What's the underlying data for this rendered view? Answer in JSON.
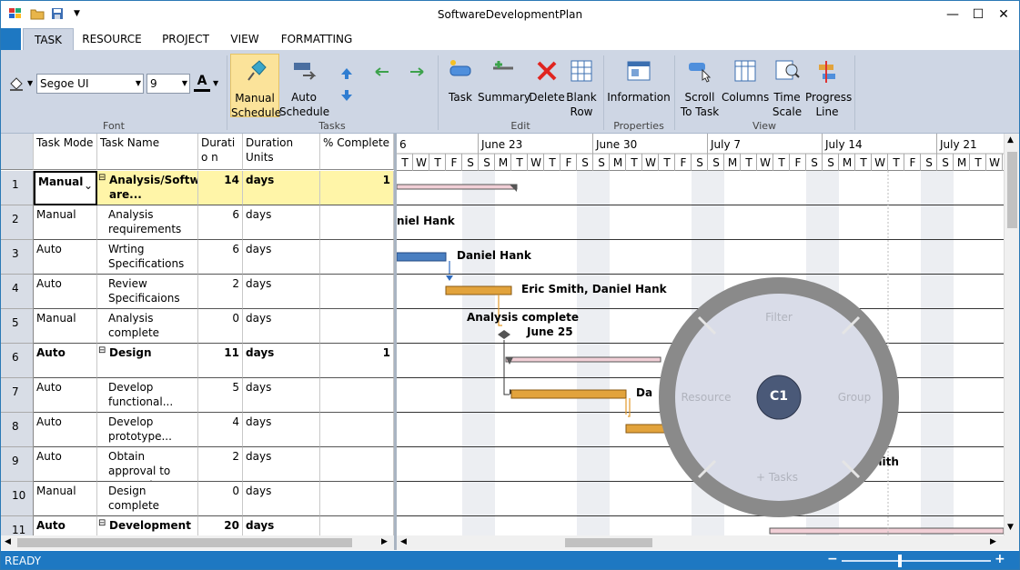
{
  "window": {
    "title": "SoftwareDevelopmentPlan"
  },
  "tabs": [
    "TASK",
    "RESOURCE",
    "PROJECT",
    "VIEW",
    "FORMATTING"
  ],
  "ribbon": {
    "font_family": "Segoe UI",
    "font_size": "9",
    "groups": {
      "font": "Font",
      "tasks": "Tasks",
      "edit": "Edit",
      "properties": "Properties",
      "view": "View"
    },
    "manual": [
      "Manual",
      "Schedule"
    ],
    "auto": [
      "Auto",
      "Schedule"
    ],
    "task": "Task",
    "summary": "Summary",
    "delete": "Delete",
    "blank": [
      "Blank",
      "Row"
    ],
    "information": "Information",
    "scroll": [
      "Scroll",
      "To Task"
    ],
    "columns": "Columns",
    "timescale": [
      "Time",
      "Scale"
    ],
    "progress": [
      "Progress",
      "Line"
    ]
  },
  "grid": {
    "headers": [
      "Task Mode",
      "Task Name",
      "Duratio n",
      "Duration Units",
      "% Complete"
    ],
    "rows": [
      {
        "id": "1",
        "mode": "Manual",
        "name": "Analysis/Softw are...",
        "dur": "14",
        "unit": "days",
        "pct": "1",
        "bold": true,
        "sel": true
      },
      {
        "id": "2",
        "mode": "Manual",
        "name": "Analysis requirements",
        "dur": "6",
        "unit": "days",
        "pct": "",
        "bold": false
      },
      {
        "id": "3",
        "mode": "Auto",
        "name": "Wrting Specifications",
        "dur": "6",
        "unit": "days",
        "pct": "",
        "bold": false
      },
      {
        "id": "4",
        "mode": "Auto",
        "name": "Review Specificaions",
        "dur": "2",
        "unit": "days",
        "pct": "",
        "bold": false
      },
      {
        "id": "5",
        "mode": "Manual",
        "name": "Analysis complete",
        "dur": "0",
        "unit": "days",
        "pct": "",
        "bold": false
      },
      {
        "id": "6",
        "mode": "Auto",
        "name": "Design",
        "dur": "11",
        "unit": "days",
        "pct": "1",
        "bold": true
      },
      {
        "id": "7",
        "mode": "Auto",
        "name": "Develop functional...",
        "dur": "5",
        "unit": "days",
        "pct": "",
        "bold": false
      },
      {
        "id": "8",
        "mode": "Auto",
        "name": "Develop prototype...",
        "dur": "4",
        "unit": "days",
        "pct": "",
        "bold": false
      },
      {
        "id": "9",
        "mode": "Auto",
        "name": "Obtain approval to proceed",
        "dur": "2",
        "unit": "days",
        "pct": "",
        "bold": false
      },
      {
        "id": "10",
        "mode": "Manual",
        "name": "Design complete",
        "dur": "0",
        "unit": "days",
        "pct": "",
        "bold": false
      },
      {
        "id": "11",
        "mode": "Auto",
        "name": "Development",
        "dur": "20",
        "unit": "days",
        "pct": "",
        "bold": true
      }
    ]
  },
  "timeline": {
    "weeks": [
      "6",
      "June 23",
      "June 30",
      "July 7",
      "July 14",
      "July 21"
    ],
    "days": [
      "T",
      "W",
      "T",
      "F",
      "S",
      "S",
      "M",
      "T",
      "W",
      "T",
      "F",
      "S",
      "S",
      "M",
      "T",
      "W",
      "T",
      "F",
      "S",
      "S",
      "M",
      "T",
      "W",
      "T",
      "F",
      "S",
      "S",
      "M",
      "T",
      "W",
      "T",
      "F",
      "S",
      "S",
      "M",
      "T",
      "W"
    ]
  },
  "chart_labels": {
    "r2": "niel Hank",
    "r3": "Daniel Hank",
    "r4": "Eric Smith, Daniel Hank",
    "r5a": "Analysis complete",
    "r5b": "June 25",
    "r7": "Da",
    "r9": "mith"
  },
  "radial": {
    "filter": "Filter",
    "resource": "Resource",
    "group": "Group",
    "tasks": "+ Tasks",
    "logo": "C1"
  },
  "status": {
    "text": "READY"
  },
  "colors": {
    "accent": "#1e78c2",
    "selected_row": "#fff5a8",
    "bar_blue": "#4a7fc1",
    "bar_orange": "#e2a33c"
  }
}
